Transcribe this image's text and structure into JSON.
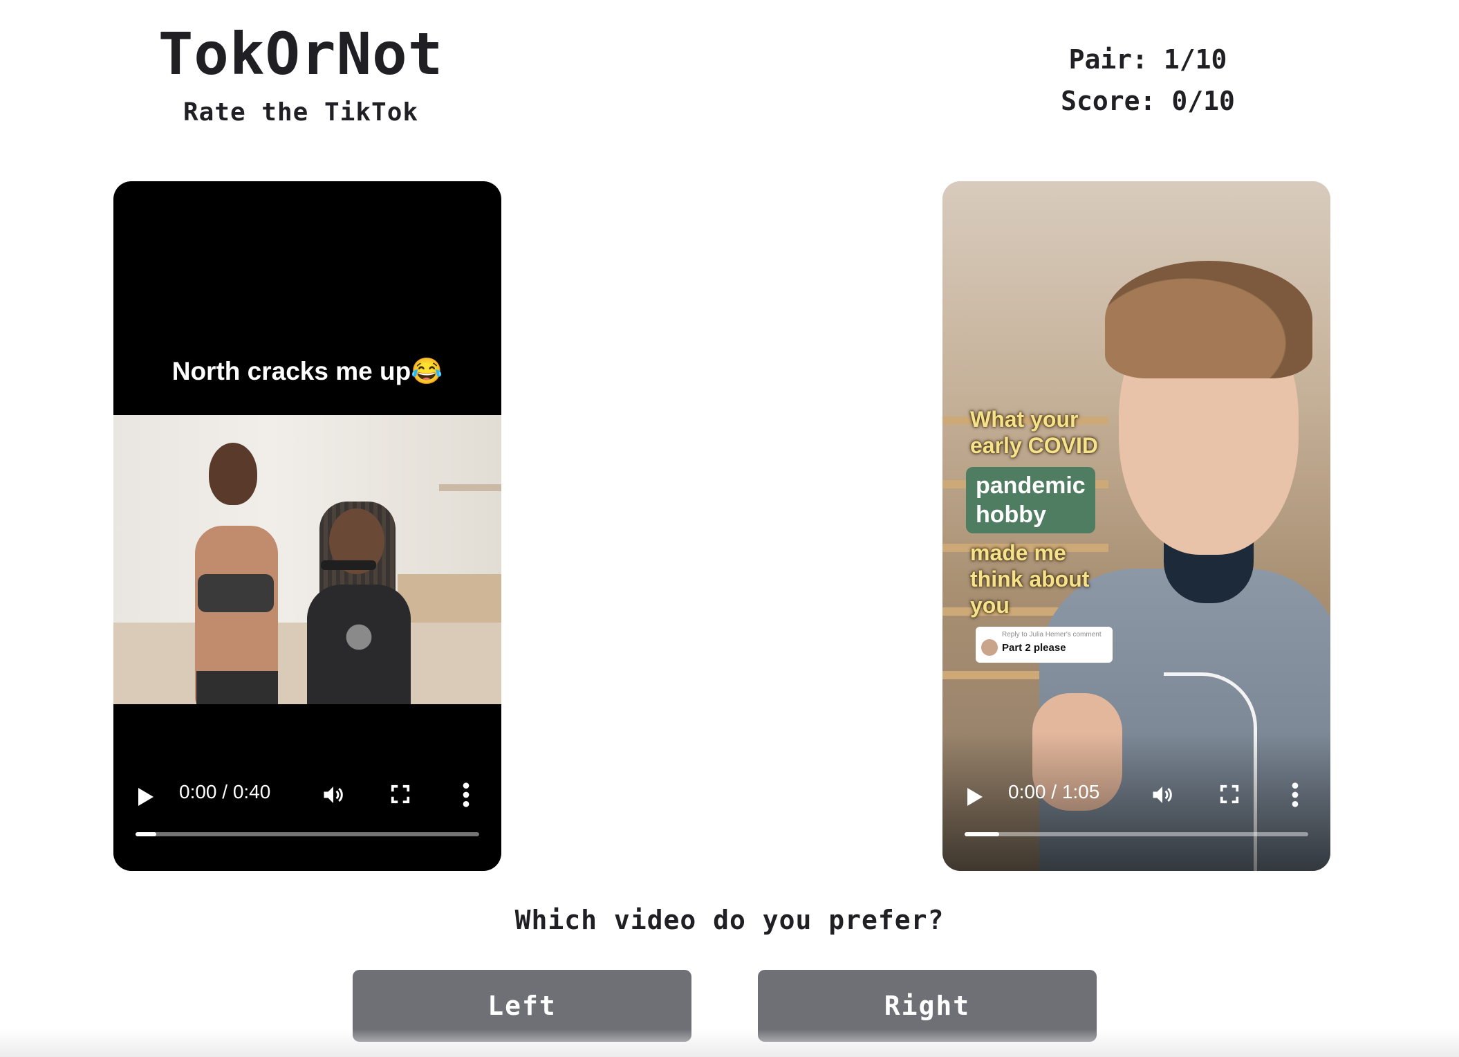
{
  "header": {
    "title": "TokOrNot",
    "subtitle": "Rate the TikTok",
    "pair_label": "Pair:",
    "pair_value": "1/10",
    "score_label": "Score:",
    "score_value": "0/10"
  },
  "videos": {
    "left": {
      "caption": "North cracks me up😂",
      "time": "0:00 / 0:40",
      "progress": 0.06
    },
    "right": {
      "overlay_line1": "What your",
      "overlay_line2": "early COVID",
      "overlay_green_1": "pandemic",
      "overlay_green_2": "hobby",
      "overlay_line3": "made me",
      "overlay_line4": "think about",
      "overlay_line5": "you",
      "reply_meta": "Reply to Julia Hemer's comment",
      "reply_text": "Part 2 please",
      "time": "0:00 / 1:05",
      "progress": 0.1
    }
  },
  "icons": {
    "play": "play-icon",
    "volume": "volume-icon",
    "fullscreen": "fullscreen-icon",
    "more": "more-vertical-icon"
  },
  "prompt": {
    "question": "Which video do you prefer?",
    "left_label": "Left",
    "right_label": "Right"
  },
  "colors": {
    "button_bg": "#6e7076",
    "text": "#1f1f24"
  }
}
